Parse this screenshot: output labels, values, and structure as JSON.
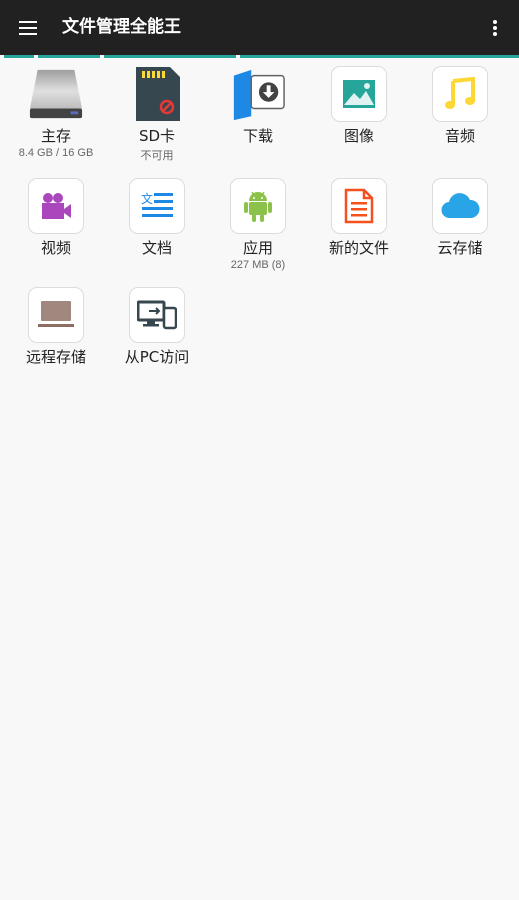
{
  "app": {
    "title": "文件管理全能王"
  },
  "colors": {
    "appbar": "#212121",
    "accent": "#26a69a"
  },
  "tiles": [
    {
      "label": "主存",
      "sub": "8.4 GB / 16 GB",
      "icon": "hard-drive-icon"
    },
    {
      "label": "SD卡",
      "sub": "不可用",
      "icon": "sd-card-icon"
    },
    {
      "label": "下载",
      "sub": "",
      "icon": "download-icon"
    },
    {
      "label": "图像",
      "sub": "",
      "icon": "image-icon"
    },
    {
      "label": "音频",
      "sub": "",
      "icon": "music-icon"
    },
    {
      "label": "视频",
      "sub": "",
      "icon": "video-icon"
    },
    {
      "label": "文档",
      "sub": "",
      "icon": "document-icon"
    },
    {
      "label": "应用",
      "sub": "227 MB (8)",
      "icon": "android-icon"
    },
    {
      "label": "新的文件",
      "sub": "",
      "icon": "new-file-icon"
    },
    {
      "label": "云存储",
      "sub": "",
      "icon": "cloud-icon"
    },
    {
      "label": "远程存储",
      "sub": "",
      "icon": "laptop-icon"
    },
    {
      "label": "从PC访问",
      "sub": "",
      "icon": "pc-access-icon"
    }
  ]
}
